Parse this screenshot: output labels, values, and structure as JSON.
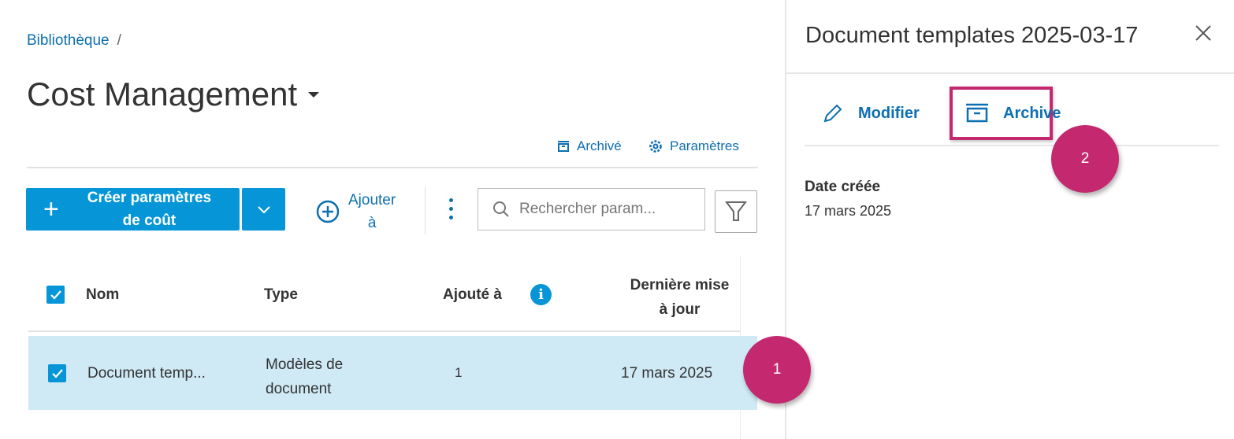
{
  "breadcrumb": {
    "root": "Bibliothèque",
    "separator": "/"
  },
  "page_title": "Cost Management",
  "top_links": {
    "archived": "Archivé",
    "settings": "Paramètres"
  },
  "toolbar": {
    "create_label_1": "Créer paramètres",
    "create_label_2": "de coût",
    "add_to_1": "Ajouter",
    "add_to_2": "à",
    "search_placeholder": "Rechercher param..."
  },
  "table": {
    "headers": {
      "name": "Nom",
      "type": "Type",
      "added_to": "Ajouté à",
      "updated_1": "Dernière mise",
      "updated_2": "à jour"
    },
    "rows": [
      {
        "name": "Document temp...",
        "type_1": "Modèles de",
        "type_2": "document",
        "added_to": "1",
        "updated": "17 mars 2025"
      }
    ]
  },
  "panel": {
    "title": "Document templates 2025-03-17",
    "edit": "Modifier",
    "archive": "Archive",
    "date_label": "Date créée",
    "date_value": "17 mars 2025"
  },
  "markers": [
    "1",
    "2"
  ],
  "colors": {
    "accent": "#0696d7",
    "link": "#0e6fb0",
    "marker": "#c4286f",
    "selected_row": "#cfe9f5"
  }
}
